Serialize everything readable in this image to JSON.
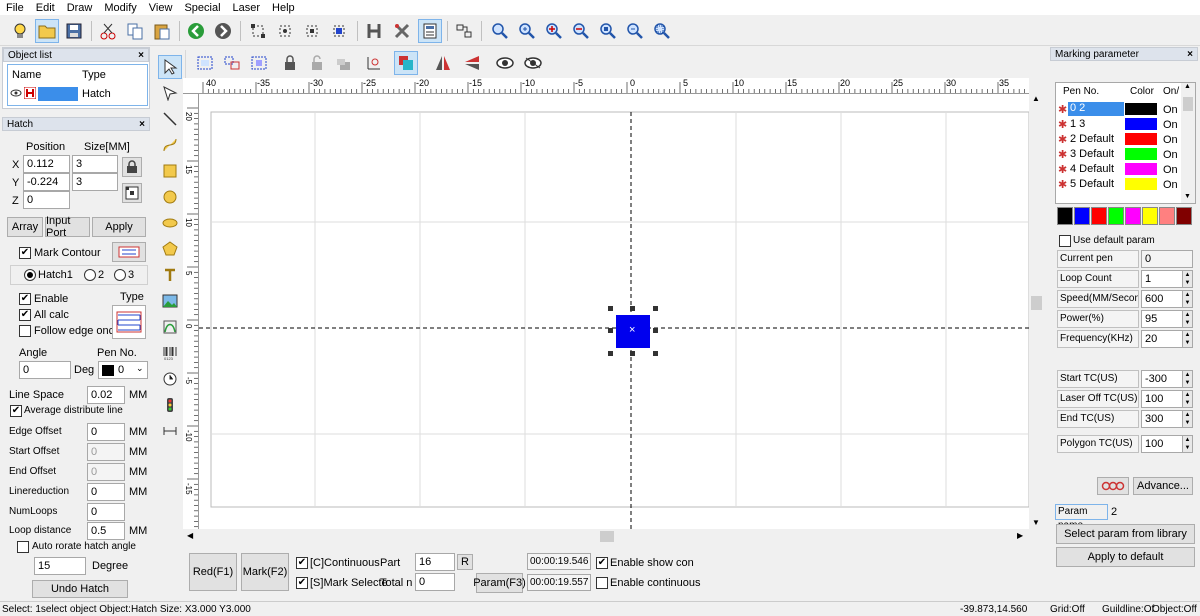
{
  "menu": [
    "File",
    "Edit",
    "Draw",
    "Modify",
    "View",
    "Special",
    "Laser",
    "Help"
  ],
  "toolbar_icons": [
    "lightbulb-icon",
    "open-folder-icon",
    "save-icon",
    "cut-icon",
    "copy-icon",
    "paste-icon",
    "back-icon",
    "forward-icon",
    "select-nodes-icon",
    "node-icon",
    "node-edit-icon",
    "node-move-icon",
    "hatch-h-icon",
    "settings-icon",
    "calculator-icon",
    "barcode-align-icon",
    "zoom-icon",
    "zoom-in-icon",
    "zoom-plus-icon",
    "zoom-minus-icon",
    "zoom-all-icon",
    "zoom-select-icon",
    "zoom-fit-icon"
  ],
  "object_list": {
    "title": "Object list",
    "col_name": "Name",
    "col_type": "Type",
    "row_type": "Hatch"
  },
  "hatch_panel": {
    "title": "Hatch",
    "position_label": "Position",
    "size_label": "Size[MM]",
    "x_label": "X",
    "y_label": "Y",
    "z_label": "Z",
    "x_pos": "0.112",
    "y_pos": "-0.224",
    "z_pos": "0",
    "x_size": "3",
    "y_size": "3",
    "array_btn": "Array",
    "input_port_btn": "Input Port",
    "apply_btn": "Apply",
    "mark_contour": "Mark Contour",
    "hatch1": "Hatch1",
    "hatch2": "2",
    "hatch3": "3",
    "enable": "Enable",
    "type_label": "Type",
    "all_calc": "All calc",
    "follow_edge": "Follow edge once",
    "angle_label": "Angle",
    "pen_no_label": "Pen No.",
    "angle_value": "0",
    "deg": "Deg",
    "pen_value": "0",
    "line_space_label": "Line Space",
    "line_space": "0.02",
    "mm": "MM",
    "avg_distribute": "Average distribute line",
    "edge_offset_label": "Edge Offset",
    "edge_offset": "0",
    "start_offset_label": "Start Offset",
    "start_offset": "0",
    "end_offset_label": "End Offset",
    "end_offset": "0",
    "linereduction_label": "Linereduction",
    "linereduction": "0",
    "numloops_label": "NumLoops",
    "numloops": "0",
    "loop_distance_label": "Loop distance",
    "loop_distance": "0.5",
    "auto_rotate": "Auto rorate hatch angle",
    "rotate_value": "15",
    "degree": "Degree",
    "undo_hatch": "Undo Hatch"
  },
  "ruler_top": [
    "40",
    "-35",
    "-30",
    "-25",
    "-20",
    "-15",
    "-10",
    "-5",
    "0",
    "5",
    "10",
    "15",
    "20",
    "25",
    "30",
    "35"
  ],
  "ruler_left": [
    "20",
    "15",
    "10",
    "5",
    "0",
    "-5",
    "-10",
    "-15"
  ],
  "bottom_bar": {
    "red_btn": "Red(F1)",
    "mark_btn": "Mark(F2)",
    "continuous": "[C]Continuous",
    "mark_selected": "[S]Mark Selecte",
    "part_label": "Part",
    "part_value": "16",
    "r_btn": "R",
    "total_label": "Total n",
    "total_value": "0",
    "param_btn": "Param(F3)",
    "time1": "00:00:19.546",
    "time2": "00:00:19.557",
    "enable_show": "Enable show con",
    "enable_continuous": "Enable continuous"
  },
  "marking_param": {
    "title": "Marking parameter",
    "col_pen": "Pen No.",
    "col_color": "Color",
    "col_on": "On/",
    "pens": [
      {
        "name": "0 2",
        "color": "#000000",
        "on": "On"
      },
      {
        "name": "1 3",
        "color": "#0000ff",
        "on": "On"
      },
      {
        "name": "2 Default",
        "color": "#ff0000",
        "on": "On"
      },
      {
        "name": "3 Default",
        "color": "#00ff00",
        "on": "On"
      },
      {
        "name": "4 Default",
        "color": "#ff00ff",
        "on": "On"
      },
      {
        "name": "5 Default",
        "color": "#ffff00",
        "on": "On"
      }
    ],
    "palette": [
      "#000000",
      "#0000ff",
      "#ff0000",
      "#00ff00",
      "#ff00ff",
      "#ffff00",
      "#ff8080",
      "#800000"
    ],
    "use_default": "Use default param",
    "current_pen_label": "Current pen",
    "current_pen": "0",
    "loop_count_label": "Loop Count",
    "loop_count": "1",
    "speed_label": "Speed(MM/Secon",
    "speed": "600",
    "power_label": "Power(%)",
    "power": "95",
    "frequency_label": "Frequency(KHz)",
    "frequency": "20",
    "start_tc_label": "Start TC(US)",
    "start_tc": "-300",
    "laser_off_label": "Laser Off TC(US)",
    "laser_off": "100",
    "end_tc_label": "End TC(US)",
    "end_tc": "300",
    "polygon_tc_label": "Polygon TC(US)",
    "polygon_tc": "100",
    "advance_btn": "Advance...",
    "param_name_label": "Param name",
    "param_name": "2",
    "select_param_btn": "Select param from library",
    "apply_default_btn": "Apply to default"
  },
  "status": {
    "left": "Select: 1select object Object:Hatch Size: X3.000 Y3.000",
    "coords": "-39.873,14.560",
    "grid": "Grid:Off",
    "guideline": "Guildline:Of",
    "object": "Object:Off"
  }
}
